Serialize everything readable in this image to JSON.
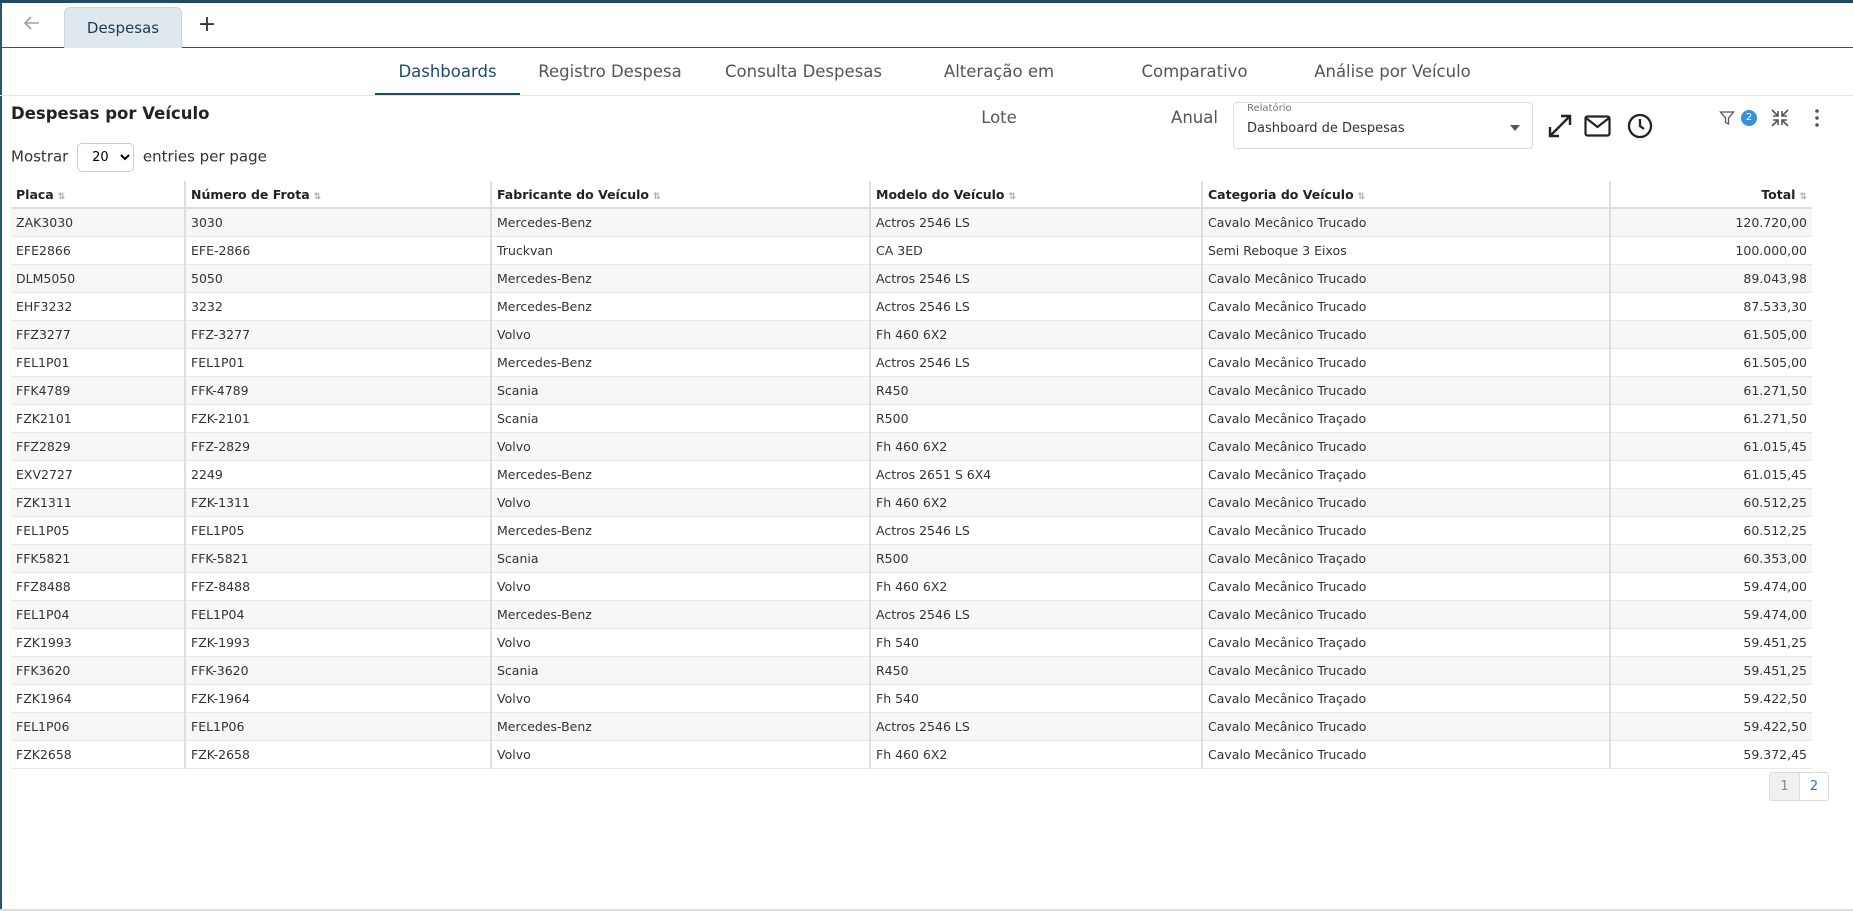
{
  "tabbar": {
    "back_icon": "arrow-left-icon",
    "tab_label": "Despesas",
    "add_label": "+"
  },
  "nav": {
    "items": [
      "Dashboards",
      "Registro Despesa",
      "Consulta Despesas",
      "Alteração em Lote",
      "Comparativo Anual",
      "Análise por Veículo"
    ],
    "active": "Dashboards"
  },
  "page": {
    "title": "Despesas por Veículo"
  },
  "report": {
    "label": "Relatório",
    "value": "Dashboard de Despesas"
  },
  "toolbar": {
    "icons": [
      "expand-icon",
      "mail-icon",
      "clock-icon",
      "filter-icon",
      "collapse-icon",
      "more-vertical-icon"
    ],
    "filter_count": "2"
  },
  "entries": {
    "prefix": "Mostrar",
    "value": "20",
    "suffix": "entries per page"
  },
  "table": {
    "columns": [
      "Placa",
      "Número de Frota",
      "Fabricante do Veículo",
      "Modelo do Veículo",
      "Categoria do Veículo",
      "Total"
    ],
    "rows": [
      [
        "ZAK3030",
        "3030",
        "Mercedes-Benz",
        "Actros 2546 LS",
        "Cavalo Mecânico Trucado",
        "120.720,00"
      ],
      [
        "EFE2866",
        "EFE-2866",
        "Truckvan",
        "CA 3ED",
        "Semi Reboque 3 Eixos",
        "100.000,00"
      ],
      [
        "DLM5050",
        "5050",
        "Mercedes-Benz",
        "Actros 2546 LS",
        "Cavalo Mecânico Trucado",
        "89.043,98"
      ],
      [
        "EHF3232",
        "3232",
        "Mercedes-Benz",
        "Actros 2546 LS",
        "Cavalo Mecânico Trucado",
        "87.533,30"
      ],
      [
        "FFZ3277",
        "FFZ-3277",
        "Volvo",
        "Fh 460 6X2",
        "Cavalo Mecânico Trucado",
        "61.505,00"
      ],
      [
        "FEL1P01",
        "FEL1P01",
        "Mercedes-Benz",
        "Actros 2546 LS",
        "Cavalo Mecânico Trucado",
        "61.505,00"
      ],
      [
        "FFK4789",
        "FFK-4789",
        "Scania",
        "R450",
        "Cavalo Mecânico Trucado",
        "61.271,50"
      ],
      [
        "FZK2101",
        "FZK-2101",
        "Scania",
        "R500",
        "Cavalo Mecânico Traçado",
        "61.271,50"
      ],
      [
        "FFZ2829",
        "FFZ-2829",
        "Volvo",
        "Fh 460 6X2",
        "Cavalo Mecânico Trucado",
        "61.015,45"
      ],
      [
        "EXV2727",
        "2249",
        "Mercedes-Benz",
        "Actros 2651 S 6X4",
        "Cavalo Mecânico Traçado",
        "61.015,45"
      ],
      [
        "FZK1311",
        "FZK-1311",
        "Volvo",
        "Fh 460 6X2",
        "Cavalo Mecânico Trucado",
        "60.512,25"
      ],
      [
        "FEL1P05",
        "FEL1P05",
        "Mercedes-Benz",
        "Actros 2546 LS",
        "Cavalo Mecânico Trucado",
        "60.512,25"
      ],
      [
        "FFK5821",
        "FFK-5821",
        "Scania",
        "R500",
        "Cavalo Mecânico Traçado",
        "60.353,00"
      ],
      [
        "FFZ8488",
        "FFZ-8488",
        "Volvo",
        "Fh 460 6X2",
        "Cavalo Mecânico Trucado",
        "59.474,00"
      ],
      [
        "FEL1P04",
        "FEL1P04",
        "Mercedes-Benz",
        "Actros 2546 LS",
        "Cavalo Mecânico Trucado",
        "59.474,00"
      ],
      [
        "FZK1993",
        "FZK-1993",
        "Volvo",
        "Fh 540",
        "Cavalo Mecânico Traçado",
        "59.451,25"
      ],
      [
        "FFK3620",
        "FFK-3620",
        "Scania",
        "R450",
        "Cavalo Mecânico Trucado",
        "59.451,25"
      ],
      [
        "FZK1964",
        "FZK-1964",
        "Volvo",
        "Fh 540",
        "Cavalo Mecânico Traçado",
        "59.422,50"
      ],
      [
        "FEL1P06",
        "FEL1P06",
        "Mercedes-Benz",
        "Actros 2546 LS",
        "Cavalo Mecânico Trucado",
        "59.422,50"
      ],
      [
        "FZK2658",
        "FZK-2658",
        "Volvo",
        "Fh 460 6X2",
        "Cavalo Mecânico Trucado",
        "59.372,45"
      ]
    ]
  },
  "pagination": {
    "pages": [
      "1",
      "2"
    ],
    "current": "1"
  }
}
